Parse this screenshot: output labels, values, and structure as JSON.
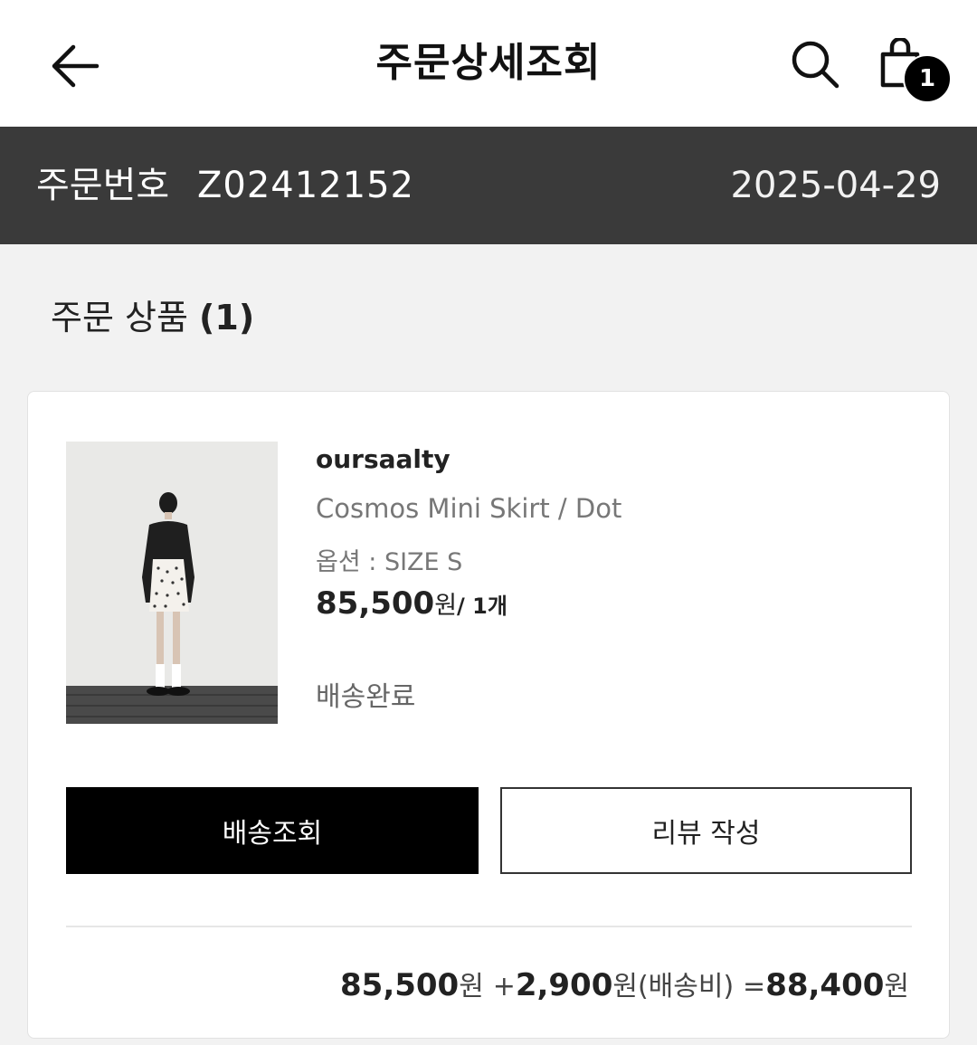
{
  "header": {
    "title": "주문상세조회",
    "back_icon": "arrow-left-icon",
    "search_icon": "search-icon",
    "cart_icon": "shopping-bag-icon",
    "cart_count": "1"
  },
  "order": {
    "label": "주문번호",
    "number": "Z02412152",
    "date": "2025-04-29"
  },
  "section": {
    "title": "주문 상품",
    "count": "(1)"
  },
  "product": {
    "brand": "oursaalty",
    "name": "Cosmos Mini Skirt / Dot",
    "option": "옵션 : SIZE S",
    "price": "85,500",
    "price_unit": "원",
    "quantity": "/ 1개",
    "status": "배송완료"
  },
  "buttons": {
    "track": "배송조회",
    "review": "리뷰 작성"
  },
  "summary": {
    "item_total": "85,500",
    "item_unit": "원",
    "plus": "+",
    "shipping": "2,900",
    "shipping_unit": "원(배송비)",
    "equals": "=",
    "grand_total": "88,400",
    "grand_unit": "원"
  },
  "colors": {
    "order_bar": "#3a3a3a",
    "primary_button": "#000000",
    "background": "#f2f2f2"
  }
}
